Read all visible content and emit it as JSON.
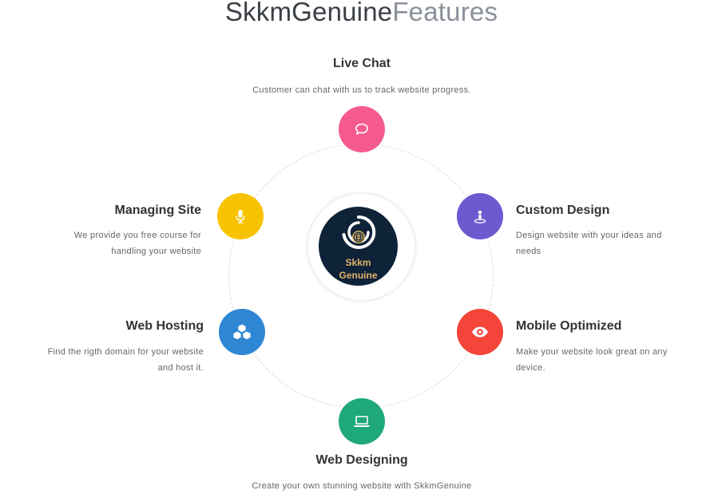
{
  "page": {
    "title_bold": "SkkmGenuine",
    "title_light": "Features"
  },
  "center_logo": {
    "line1": "Skkm",
    "line2": "Genuine",
    "bg_color": "#0e2238",
    "text_color": "#e3b36a"
  },
  "features": {
    "live_chat": {
      "title": "Live Chat",
      "description": "Customer can chat with us to track website progress.",
      "icon": "chat-bubble-icon",
      "color": "#f55a8f"
    },
    "custom_design": {
      "title": "Custom Design",
      "description_line1": "Design website with your ideas and",
      "description_line2": "needs",
      "icon": "person-pin-icon",
      "color": "#6b5ad0"
    },
    "mobile_optimized": {
      "title": "Mobile Optimized",
      "description_line1": "Make your website look great on any",
      "description_line2": "device.",
      "icon": "eye-icon",
      "color": "#f5453a"
    },
    "web_designing": {
      "title": "Web Designing",
      "description": "Create your own stunning website with SkkmGenuine",
      "icon": "laptop-icon",
      "color": "#1fa87b"
    },
    "web_hosting": {
      "title": "Web Hosting",
      "description_line1": "Find the rigth domain for your website",
      "description_line2": "and host it.",
      "icon": "cubes-icon",
      "color": "#2f86d3"
    },
    "managing_site": {
      "title": "Managing Site",
      "description_line1": "We provide you free course for",
      "description_line2": "handling your website",
      "icon": "microphone-icon",
      "color": "#f7c300"
    }
  }
}
